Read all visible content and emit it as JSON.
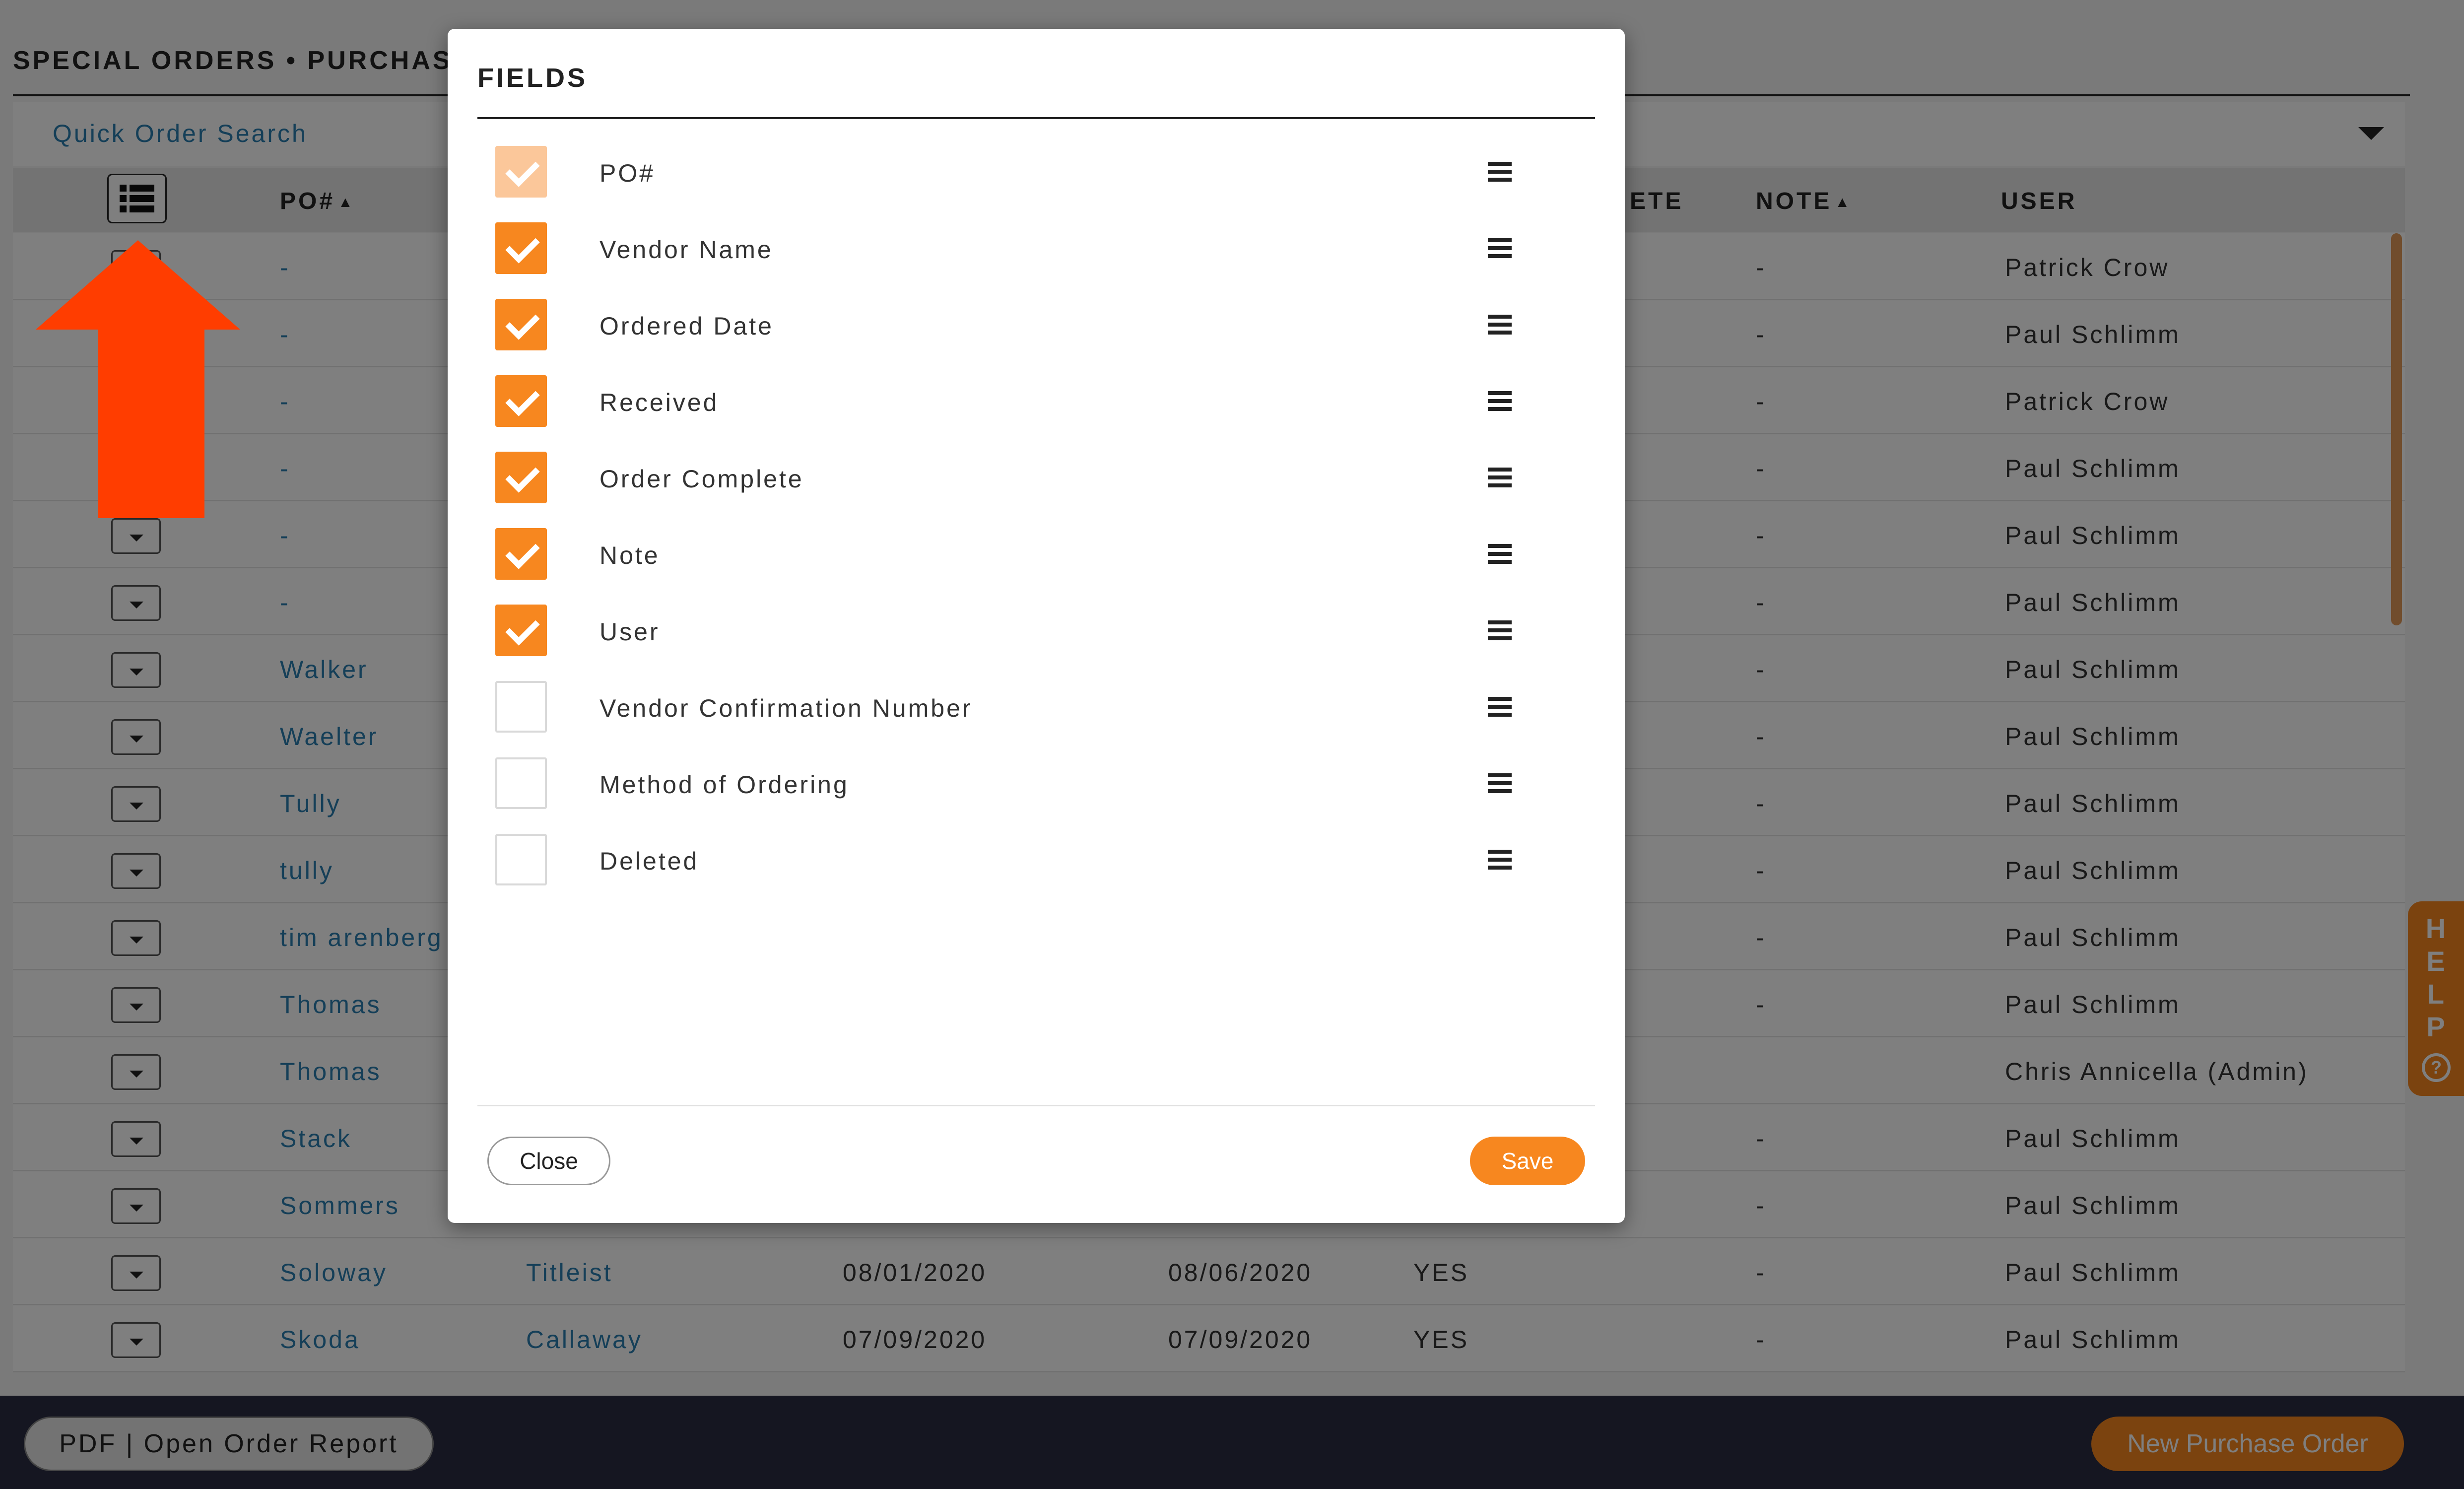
{
  "page": {
    "title": "SPECIAL ORDERS • PURCHASE",
    "search_label": "Quick Order Search"
  },
  "table": {
    "headers": {
      "po": "PO#",
      "note": "NOTE",
      "user": "USER",
      "complete_partial": "ETE"
    },
    "rows": [
      {
        "po": "-",
        "vendor": "",
        "ordered": "",
        "received": "",
        "complete": "",
        "note": "-",
        "user": "Patrick Crow"
      },
      {
        "po": "-",
        "vendor": "",
        "ordered": "",
        "received": "",
        "complete": "",
        "note": "-",
        "user": "Paul Schlimm"
      },
      {
        "po": "-",
        "vendor": "",
        "ordered": "",
        "received": "",
        "complete": "",
        "note": "-",
        "user": "Patrick Crow"
      },
      {
        "po": "-",
        "vendor": "",
        "ordered": "",
        "received": "",
        "complete": "",
        "note": "-",
        "user": "Paul Schlimm"
      },
      {
        "po": "-",
        "vendor": "",
        "ordered": "",
        "received": "",
        "complete": "",
        "note": "-",
        "user": "Paul Schlimm"
      },
      {
        "po": "-",
        "vendor": "",
        "ordered": "",
        "received": "",
        "complete": "",
        "note": "-",
        "user": "Paul Schlimm"
      },
      {
        "po": "Walker",
        "vendor": "",
        "ordered": "",
        "received": "",
        "complete": "",
        "note": "-",
        "user": "Paul Schlimm"
      },
      {
        "po": "Waelter",
        "vendor": "",
        "ordered": "",
        "received": "",
        "complete": "",
        "note": "-",
        "user": "Paul Schlimm"
      },
      {
        "po": "Tully",
        "vendor": "",
        "ordered": "",
        "received": "",
        "complete": "",
        "note": "-",
        "user": "Paul Schlimm"
      },
      {
        "po": "tully",
        "vendor": "",
        "ordered": "",
        "received": "",
        "complete": "",
        "note": "-",
        "user": "Paul Schlimm"
      },
      {
        "po": "tim arenberg",
        "vendor": "",
        "ordered": "",
        "received": "",
        "complete": "",
        "note": "-",
        "user": "Paul Schlimm"
      },
      {
        "po": "Thomas",
        "vendor": "",
        "ordered": "",
        "received": "",
        "complete": "",
        "note": "-",
        "user": "Paul Schlimm"
      },
      {
        "po": "Thomas",
        "vendor": "",
        "ordered": "",
        "received": "",
        "complete": "",
        "note": "",
        "user": "Chris Annicella (Admin)"
      },
      {
        "po": "Stack",
        "vendor": "",
        "ordered": "",
        "received": "",
        "complete": "",
        "note": "-",
        "user": "Paul Schlimm"
      },
      {
        "po": "Sommers",
        "vendor": "",
        "ordered": "",
        "received": "",
        "complete": "",
        "note": "-",
        "user": "Paul Schlimm"
      },
      {
        "po": "Soloway",
        "vendor": "Titleist",
        "ordered": "08/01/2020",
        "received": "08/06/2020",
        "complete": "YES",
        "note": "-",
        "user": "Paul Schlimm"
      },
      {
        "po": "Skoda",
        "vendor": "Callaway",
        "ordered": "07/09/2020",
        "received": "07/09/2020",
        "complete": "YES",
        "note": "-",
        "user": "Paul Schlimm"
      }
    ]
  },
  "modal": {
    "title": "FIELDS",
    "fields": [
      {
        "label": "PO#",
        "state": "disabled"
      },
      {
        "label": "Vendor Name",
        "state": "checked"
      },
      {
        "label": "Ordered Date",
        "state": "checked"
      },
      {
        "label": "Received",
        "state": "checked"
      },
      {
        "label": "Order Complete",
        "state": "checked"
      },
      {
        "label": "Note",
        "state": "checked"
      },
      {
        "label": "User",
        "state": "checked"
      },
      {
        "label": "Vendor Confirmation Number",
        "state": "unchecked"
      },
      {
        "label": "Method of Ordering",
        "state": "unchecked"
      },
      {
        "label": "Deleted",
        "state": "unchecked"
      }
    ],
    "close_label": "Close",
    "save_label": "Save"
  },
  "footer": {
    "pdf_label": "PDF | Open Order Report",
    "new_po_label": "New Purchase Order"
  },
  "help": {
    "letters": [
      "H",
      "E",
      "L",
      "P"
    ],
    "question_mark": "?"
  },
  "icons": {
    "column_settings": "list-icon",
    "row_toggle": "chevron-down-icon",
    "drag_handle": "drag-handle-icon",
    "annotation": "arrow-up-icon"
  },
  "colors": {
    "accent": "#f7871f",
    "accent_disabled": "#fbc79a",
    "link": "#2a7fb0",
    "footer_bg": "#2b2d42",
    "annotation_arrow": "#ff3d00"
  }
}
